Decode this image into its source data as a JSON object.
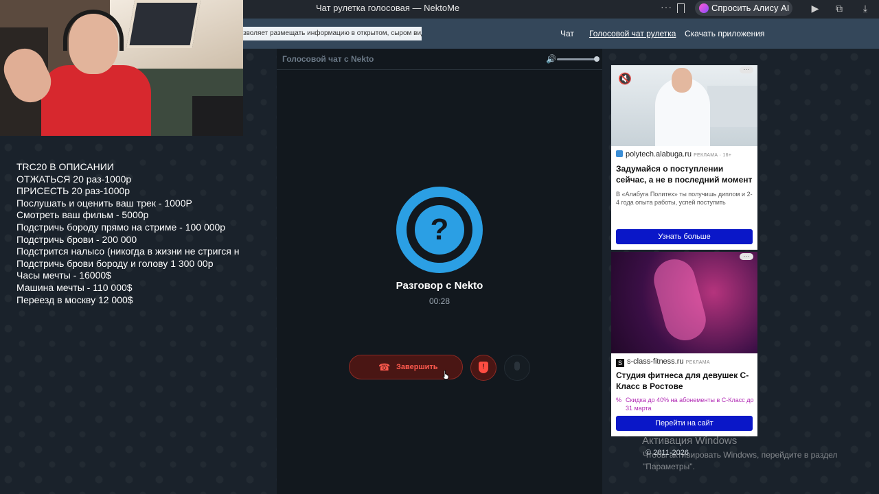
{
  "browser": {
    "tab_title": "Чат рулетка голосовая — NektoMe",
    "dots": "···",
    "alice_label": "Спросить Алису AI"
  },
  "header": {
    "notice": "зволяет размещать информацию в открытом, сыром виде!",
    "nav": [
      "Чат",
      "Голосовой чат рулетка",
      "Скачать приложения"
    ]
  },
  "overlay_lines": [
    "TRC20 В ОПИСАНИИ",
    "ОТЖАТЬСЯ 20 раз-1000р",
    "ПРИСЕСТЬ 20 раз-1000р",
    "Послушать и оценить ваш трек - 1000Р",
    "Смотреть ваш фильм - 5000р",
    "Подстричь бороду прямо на стриме - 100 000р",
    "Подстричь брови - 200 000",
    "Подстрится налысо (никогда в жизни не стригся н",
    "Подстричь брови бороду и голову 1 300 00р",
    "Часы мечты - 16000$",
    "Машина мечты - 110 000$",
    "Переезд в москву 12 000$"
  ],
  "panel": {
    "title": "Голосовой чат с Nekto",
    "avatar_symbol": "?",
    "conversation_title": "Разговор с Nekto",
    "timer": "00:28",
    "end_label": "Завершить",
    "report_symbol": "!",
    "volume_level": 1.0
  },
  "ads": [
    {
      "source": "polytech.alabuga.ru",
      "tag": "РЕКЛАМА · 16+",
      "headline": "Задумайся о поступлении сейчас, а не в последний момент",
      "description": "В «Алабуга Политех» ты получишь диплом и 2-4 года опыта работы, успей поступить",
      "cta": "Узнать больше"
    },
    {
      "source": "s-class-fitness.ru",
      "tag": "РЕКЛАМА",
      "logo_letter": "S",
      "headline": "Студия фитнеса для девушек С-Класс в Ростове",
      "promo": "Скидка до 40% на абонементы в С-Класс до 31 марта",
      "cta": "Перейти на сайт"
    }
  ],
  "footer": {
    "copyright": "© 2011-2026",
    "windows_title": "Активация Windows",
    "windows_sub": "Чтобы активировать Windows, перейдите в раздел \"Параметры\"."
  },
  "colors": {
    "accent_blue": "#2b9fe4",
    "end_red": "#ff5a4e",
    "ad_button": "#0a17c8",
    "promo": "#b129b4"
  }
}
